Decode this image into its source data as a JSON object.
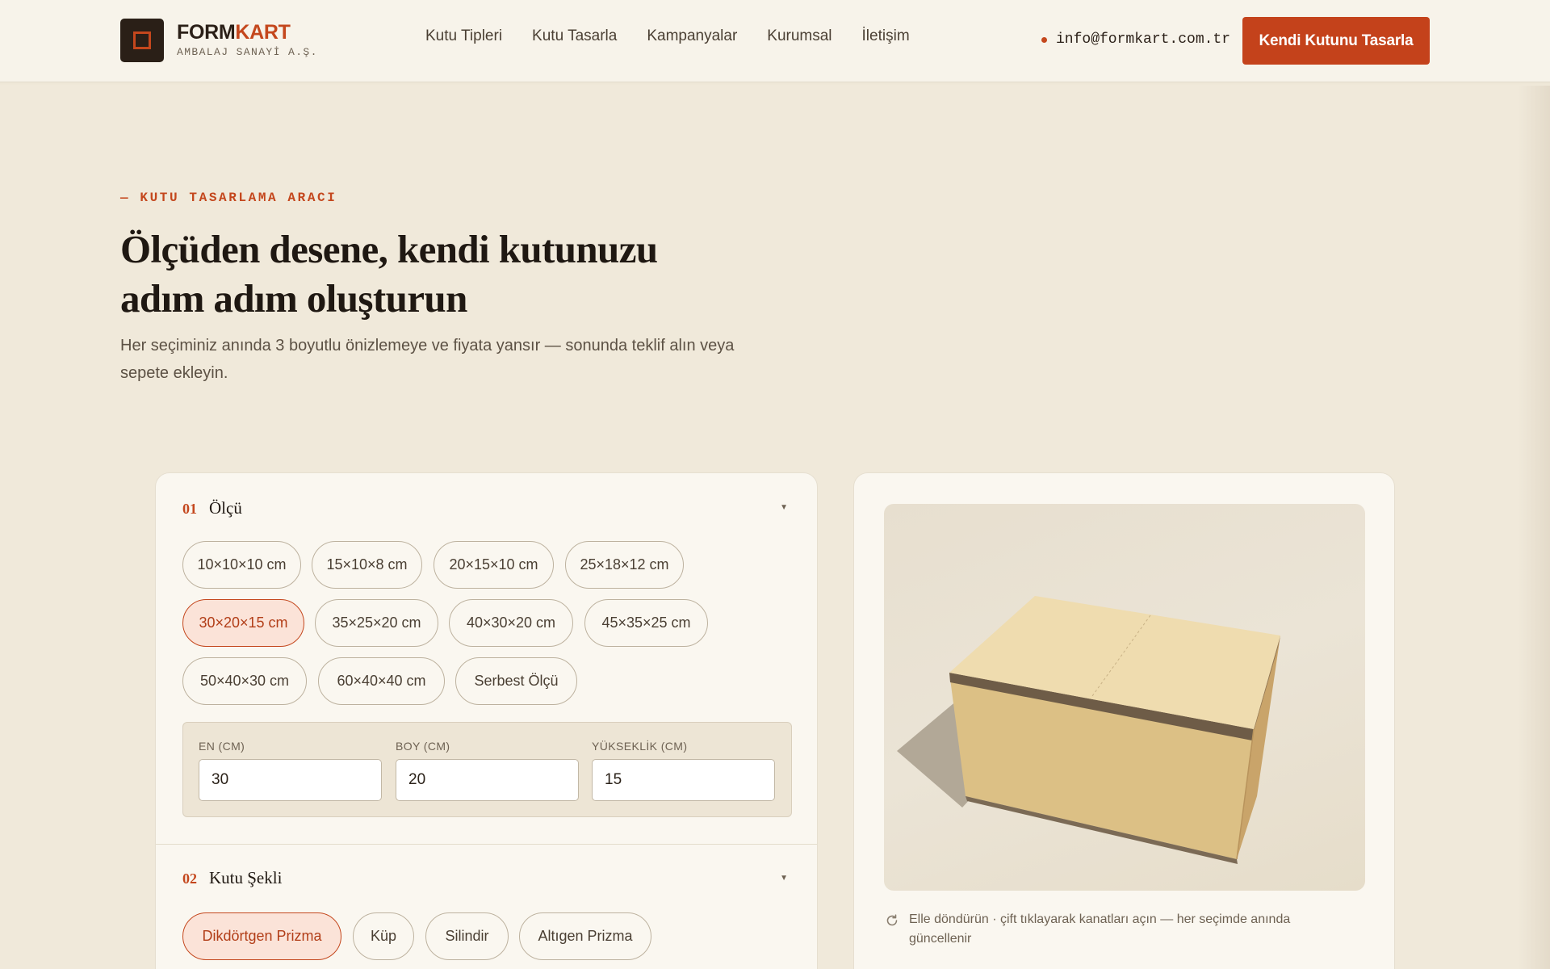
{
  "header": {
    "brand_main": "FORM",
    "brand_accent": "KART",
    "brand_sub": "AMBALAJ SANAYİ A.Ş.",
    "nav": [
      "Kutu Tipleri",
      "Kutu Tasarla",
      "Kampanyalar",
      "Kurumsal",
      "İletişim"
    ],
    "email": "info@formkart.com.tr",
    "cta_label": "Kendi Kutunu Tasarla"
  },
  "hero": {
    "eyebrow": "— KUTU TASARLAMA ARACI",
    "title": "Ölçüden desene, kendi kutunuzu adım adım oluşturun",
    "subtitle": "Her seçiminiz anında 3 boyutlu önizlemeye ve fiyata yansır — sonunda teklif alın veya sepete ekleyin."
  },
  "sections": {
    "size": {
      "number": "01",
      "title": "Ölçü",
      "options": [
        "10×10×10 cm",
        "15×10×8 cm",
        "20×15×10 cm",
        "25×18×12 cm",
        "30×20×15 cm",
        "35×25×20 cm",
        "40×30×20 cm",
        "45×35×25 cm",
        "50×40×30 cm",
        "60×40×40 cm",
        "Serbest Ölçü"
      ],
      "selected": "30×20×15 cm",
      "inputs": {
        "width_label": "EN (CM)",
        "width_value": "30",
        "length_label": "BOY (CM)",
        "length_value": "20",
        "height_label": "YÜKSEKLİK (CM)",
        "height_value": "15"
      }
    },
    "shape": {
      "number": "02",
      "title": "Kutu Şekli",
      "options": [
        "Dikdörtgen Prizma",
        "Küp",
        "Silindir",
        "Altıgen Prizma"
      ],
      "selected": "Dikdörtgen Prizma"
    }
  },
  "preview": {
    "hint": "Elle döndürün · çift tıklayarak kanatları açın — her seçimde anında güncellenir"
  },
  "colors": {
    "accent": "#c4471d",
    "background": "#f0e9da",
    "panel": "#faf7f0",
    "cardboard": "#dfc286"
  }
}
